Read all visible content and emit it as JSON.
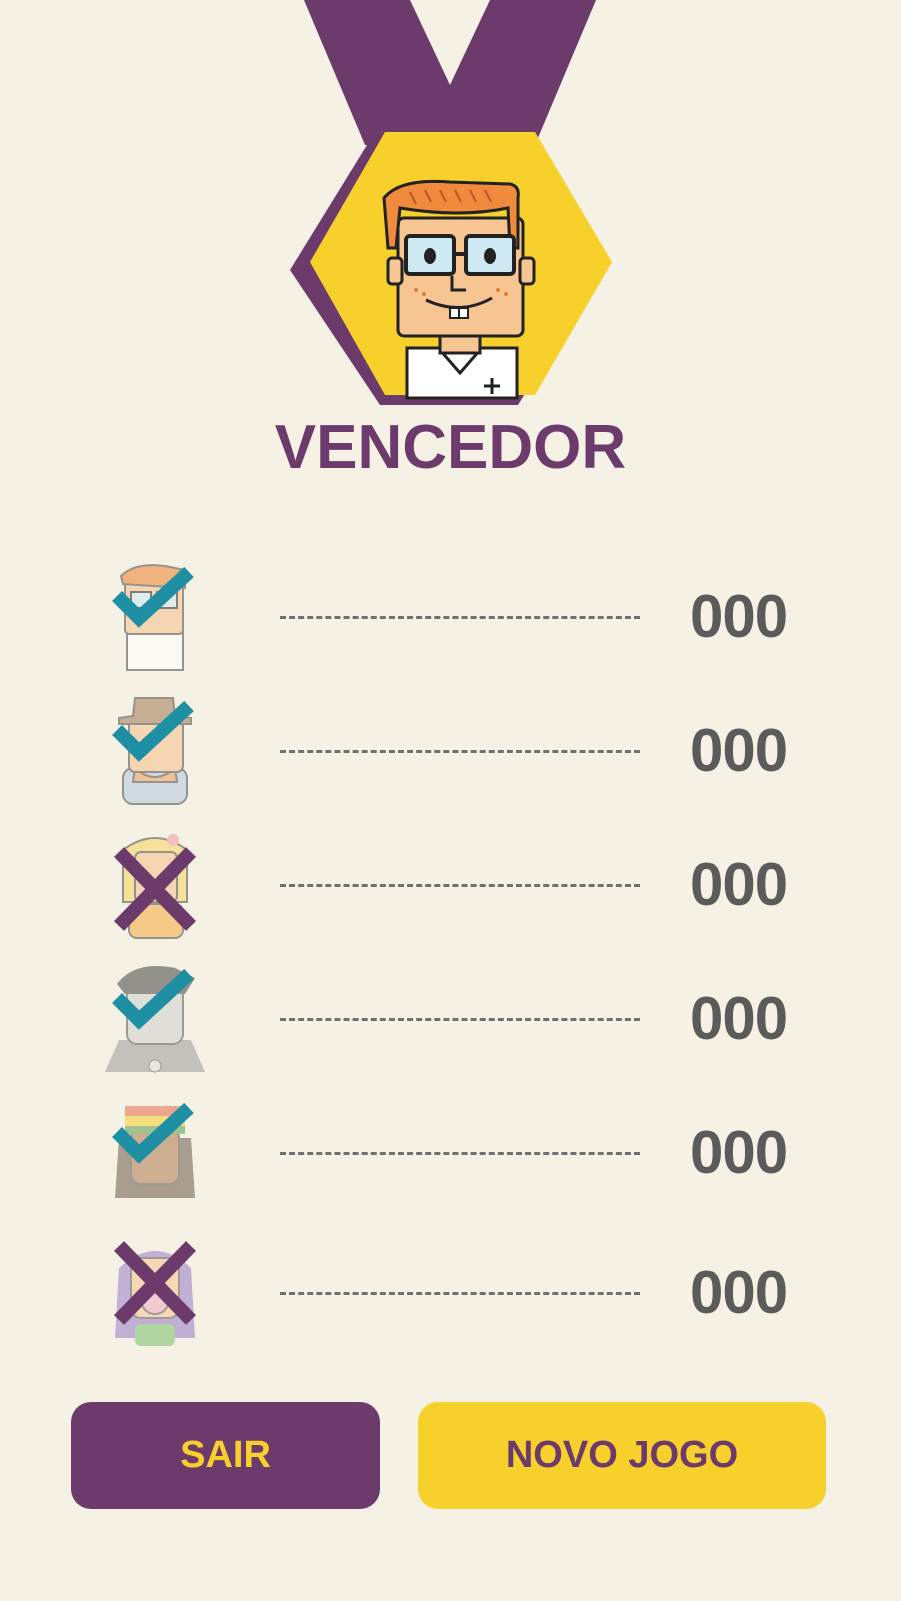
{
  "header": {
    "title": "VENCEDOR"
  },
  "players": [
    {
      "character": "nerd",
      "status": "check",
      "score": "000"
    },
    {
      "character": "detective",
      "status": "check",
      "score": "000"
    },
    {
      "character": "blonde-girl",
      "status": "cross",
      "score": "000"
    },
    {
      "character": "vampire",
      "status": "check",
      "score": "000"
    },
    {
      "character": "rasta",
      "status": "check",
      "score": "000"
    },
    {
      "character": "bubblegum-girl",
      "status": "cross",
      "score": "000"
    }
  ],
  "actions": {
    "exit_label": "SAIR",
    "new_game_label": "NOVO JOGO"
  },
  "colors": {
    "background": "#f5f1e4",
    "purple": "#6c3b6b",
    "yellow": "#f7d02c",
    "teal": "#1f8fa3",
    "score_gray": "#5b5b5b"
  }
}
